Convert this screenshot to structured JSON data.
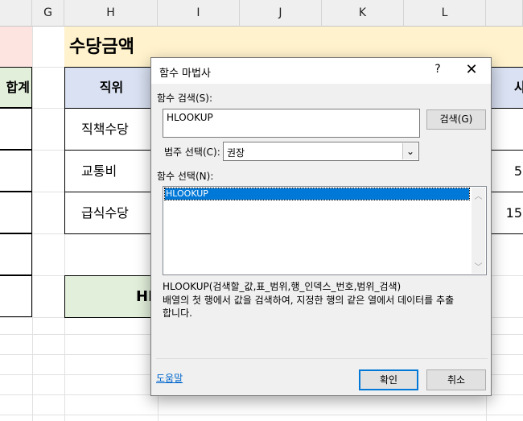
{
  "columns": [
    "G",
    "H",
    "I",
    "J",
    "K",
    "L"
  ],
  "sheet": {
    "title": "수당금액",
    "left_header_fragment": "합계",
    "header_position": "직위",
    "header_right_fragment": "사",
    "rows": [
      {
        "label": "직책수당",
        "right_value": ""
      },
      {
        "label": "교통비",
        "right_value": "5"
      },
      {
        "label": "급식수당",
        "right_value": "15"
      }
    ],
    "bottom_fragment": "HI"
  },
  "dialog": {
    "title": "함수 마법사",
    "help_label": "?",
    "close_label": "✕",
    "search_label": "함수 검색(S):",
    "search_value": "HLOOKUP",
    "search_button": "검색(G)",
    "category_label": "범주 선택(C):",
    "category_value": "권장",
    "function_label": "함수 선택(N):",
    "functions": [
      "HLOOKUP"
    ],
    "syntax": "HLOOKUP(검색할_값,표_범위,행_인덱스_번호,범위_검색)",
    "description": "배열의 첫 행에서 값을 검색하여, 지정한 행의 같은 열에서 데이터를 추출합니다.",
    "help_link": "도움말",
    "ok_button": "확인",
    "cancel_button": "취소"
  }
}
